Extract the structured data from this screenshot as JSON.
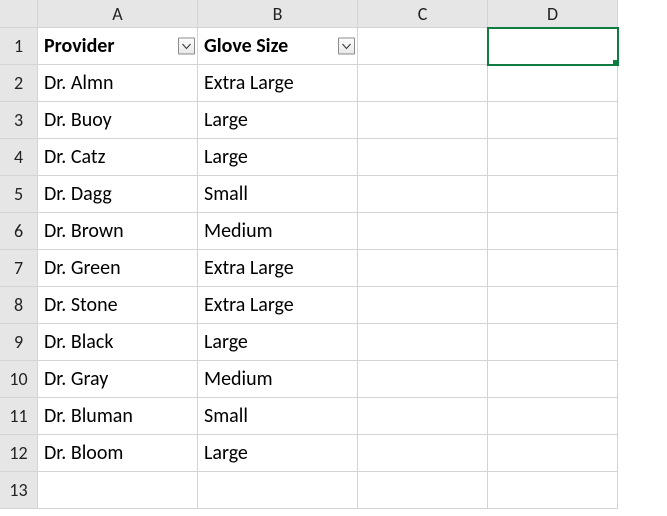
{
  "columns": [
    "A",
    "B",
    "C",
    "D"
  ],
  "row_numbers": [
    "1",
    "2",
    "3",
    "4",
    "5",
    "6",
    "7",
    "8",
    "9",
    "10",
    "11",
    "12",
    "13"
  ],
  "headers": {
    "provider": "Provider",
    "glove_size": "Glove Size"
  },
  "rows": [
    {
      "provider": "Dr. Almn",
      "glove_size": "Extra Large"
    },
    {
      "provider": "Dr. Buoy",
      "glove_size": "Large"
    },
    {
      "provider": "Dr. Catz",
      "glove_size": "Large"
    },
    {
      "provider": "Dr. Dagg",
      "glove_size": "Small"
    },
    {
      "provider": "Dr. Brown",
      "glove_size": "Medium"
    },
    {
      "provider": "Dr. Green",
      "glove_size": "Extra Large"
    },
    {
      "provider": "Dr. Stone",
      "glove_size": "Extra Large"
    },
    {
      "provider": "Dr. Black",
      "glove_size": "Large"
    },
    {
      "provider": "Dr. Gray",
      "glove_size": "Medium"
    },
    {
      "provider": "Dr. Bluman",
      "glove_size": "Small"
    },
    {
      "provider": "Dr. Bloom",
      "glove_size": "Large"
    }
  ],
  "selected_cell": "D1",
  "colors": {
    "selection": "#107c41",
    "grid": "#d4d4d4",
    "header_bg": "#e6e6e6"
  },
  "chart_data": {
    "type": "table",
    "columns": [
      "Provider",
      "Glove Size"
    ],
    "data": [
      [
        "Dr. Almn",
        "Extra Large"
      ],
      [
        "Dr. Buoy",
        "Large"
      ],
      [
        "Dr. Catz",
        "Large"
      ],
      [
        "Dr. Dagg",
        "Small"
      ],
      [
        "Dr. Brown",
        "Medium"
      ],
      [
        "Dr. Green",
        "Extra Large"
      ],
      [
        "Dr. Stone",
        "Extra Large"
      ],
      [
        "Dr. Black",
        "Large"
      ],
      [
        "Dr. Gray",
        "Medium"
      ],
      [
        "Dr. Bluman",
        "Small"
      ],
      [
        "Dr. Bloom",
        "Large"
      ]
    ]
  }
}
